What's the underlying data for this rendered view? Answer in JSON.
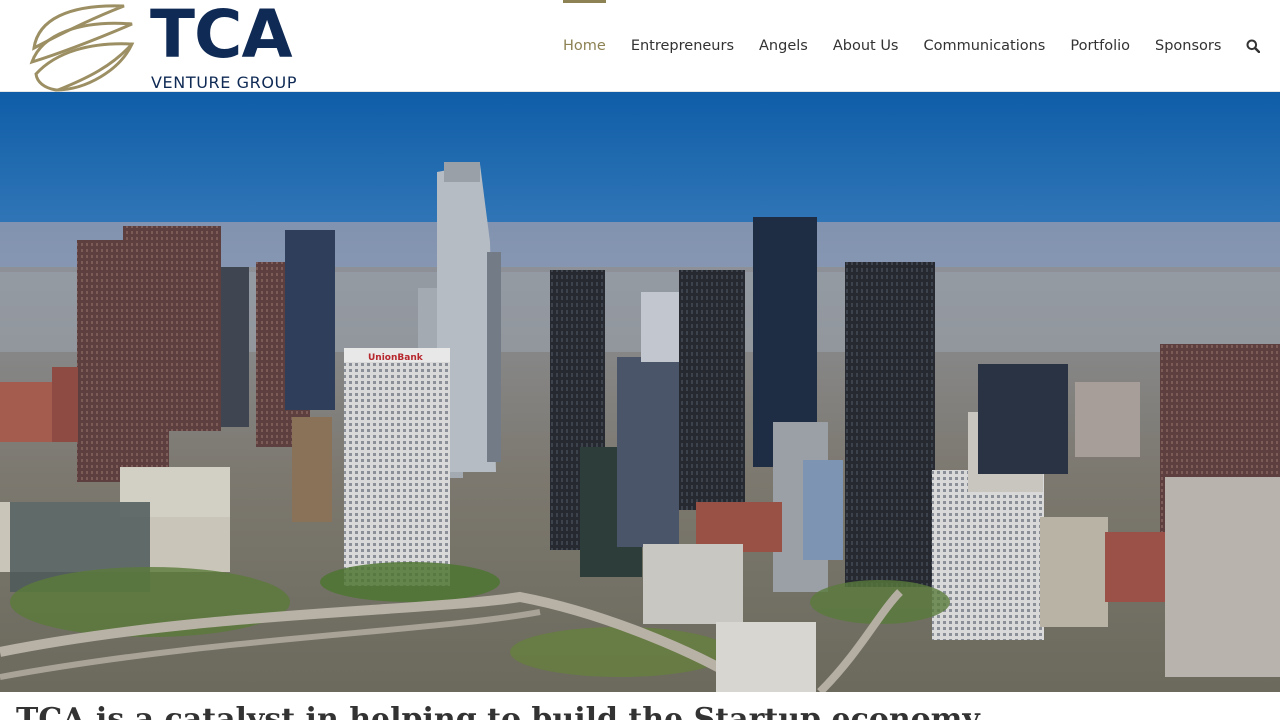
{
  "brand": {
    "logo_main": "TCA",
    "logo_sub": "VENTURE GROUP",
    "colors": {
      "navy": "#0f2a55",
      "gold": "#9c8f63",
      "accent": "#8c8253"
    }
  },
  "nav": {
    "items": [
      {
        "label": "Home",
        "active": true
      },
      {
        "label": "Entrepreneurs",
        "active": false
      },
      {
        "label": "Angels",
        "active": false
      },
      {
        "label": "About Us",
        "active": false
      },
      {
        "label": "Communications",
        "active": false
      },
      {
        "label": "Portfolio",
        "active": false
      },
      {
        "label": "Sponsors",
        "active": false
      }
    ],
    "search_icon": "search-icon"
  },
  "hero": {
    "image": "aerial-city-skyline",
    "building_sign": "UnionBank"
  },
  "headline": "TCA is a catalyst in helping to build the Startup economy"
}
